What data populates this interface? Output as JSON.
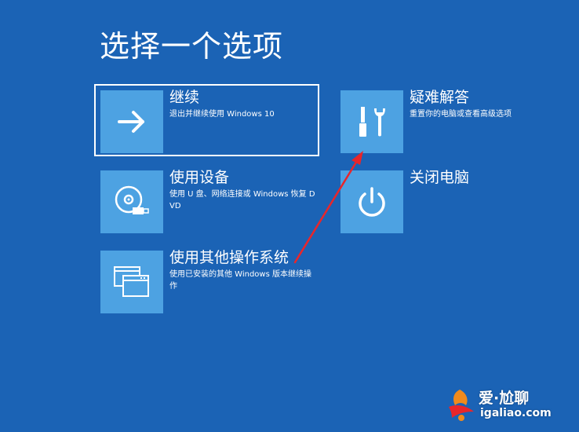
{
  "page": {
    "title": "选择一个选项"
  },
  "options": [
    {
      "id": "continue",
      "title": "继续",
      "description": "退出并继续使用 Windows 10",
      "icon": "arrow-right-icon",
      "focused": true
    },
    {
      "id": "use-device",
      "title": "使用设备",
      "description": "使用 U 盘、网络连接或 Windows 恢复 DVD",
      "icon": "disc-usb-icon",
      "focused": false
    },
    {
      "id": "other-os",
      "title": "使用其他操作系统",
      "description": "使用已安装的其他 Windows 版本继续操作",
      "icon": "windows-stack-icon",
      "focused": false
    },
    {
      "id": "troubleshoot",
      "title": "疑难解答",
      "description": "重置你的电脑或查看高级选项",
      "icon": "tools-icon",
      "focused": false
    },
    {
      "id": "shutdown",
      "title": "关闭电脑",
      "description": "",
      "icon": "power-icon",
      "focused": false
    }
  ],
  "watermark": {
    "top_text": "爱·尬聊",
    "bottom_text": "igaliao.com"
  },
  "colors": {
    "background": "#1b63b5",
    "tile": "#4da2e2",
    "annotation_arrow": "#e8262b"
  }
}
